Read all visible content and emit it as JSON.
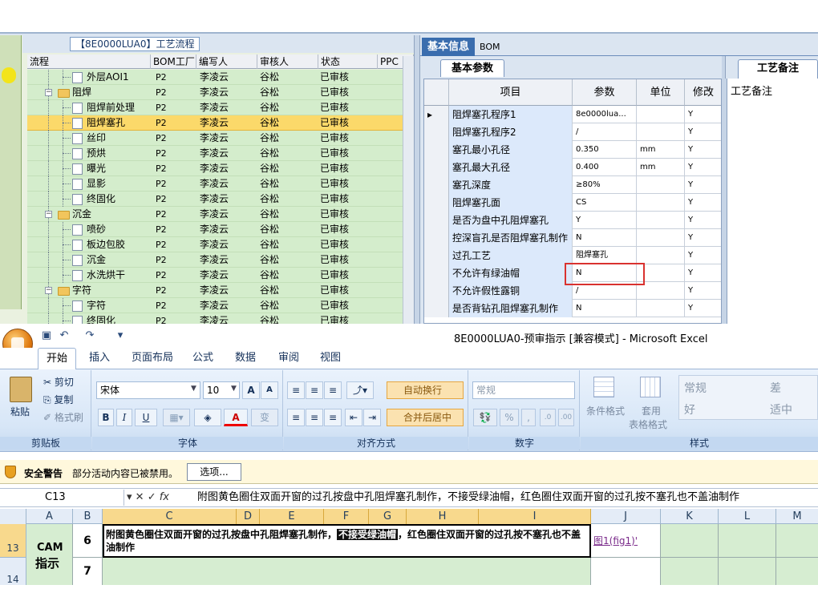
{
  "tree": {
    "title": "【8E0000LUA0】工艺流程",
    "columns": [
      "流程",
      "BOM工厂",
      "编写人",
      "审核人",
      "状态",
      "PPC"
    ],
    "rows": [
      {
        "name": "外层AOI1",
        "level": 2,
        "type": "doc",
        "plant": "P2",
        "writer": "李凌云",
        "reviewer": "谷松",
        "status": "已审核"
      },
      {
        "name": "阻焊",
        "level": 1,
        "type": "folder",
        "plant": "P2",
        "writer": "李凌云",
        "reviewer": "谷松",
        "status": "已审核"
      },
      {
        "name": "阻焊前处理",
        "level": 2,
        "type": "doc",
        "plant": "P2",
        "writer": "李凌云",
        "reviewer": "谷松",
        "status": "已审核"
      },
      {
        "name": "阻焊塞孔",
        "level": 2,
        "type": "doc",
        "plant": "P2",
        "writer": "李凌云",
        "reviewer": "谷松",
        "status": "已审核",
        "selected": true
      },
      {
        "name": "丝印",
        "level": 2,
        "type": "doc",
        "plant": "P2",
        "writer": "李凌云",
        "reviewer": "谷松",
        "status": "已审核"
      },
      {
        "name": "预烘",
        "level": 2,
        "type": "doc",
        "plant": "P2",
        "writer": "李凌云",
        "reviewer": "谷松",
        "status": "已审核"
      },
      {
        "name": "曝光",
        "level": 2,
        "type": "doc",
        "plant": "P2",
        "writer": "李凌云",
        "reviewer": "谷松",
        "status": "已审核"
      },
      {
        "name": "显影",
        "level": 2,
        "type": "doc",
        "plant": "P2",
        "writer": "李凌云",
        "reviewer": "谷松",
        "status": "已审核"
      },
      {
        "name": "终固化",
        "level": 2,
        "type": "doc",
        "plant": "P2",
        "writer": "李凌云",
        "reviewer": "谷松",
        "status": "已审核"
      },
      {
        "name": "沉金",
        "level": 1,
        "type": "folder",
        "plant": "P2",
        "writer": "李凌云",
        "reviewer": "谷松",
        "status": "已审核"
      },
      {
        "name": "喷砂",
        "level": 2,
        "type": "doc",
        "plant": "P2",
        "writer": "李凌云",
        "reviewer": "谷松",
        "status": "已审核"
      },
      {
        "name": "板边包胶",
        "level": 2,
        "type": "doc",
        "plant": "P2",
        "writer": "李凌云",
        "reviewer": "谷松",
        "status": "已审核"
      },
      {
        "name": "沉金",
        "level": 2,
        "type": "doc",
        "plant": "P2",
        "writer": "李凌云",
        "reviewer": "谷松",
        "status": "已审核"
      },
      {
        "name": "水洗烘干",
        "level": 2,
        "type": "doc",
        "plant": "P2",
        "writer": "李凌云",
        "reviewer": "谷松",
        "status": "已审核"
      },
      {
        "name": "字符",
        "level": 1,
        "type": "folder",
        "plant": "P2",
        "writer": "李凌云",
        "reviewer": "谷松",
        "status": "已审核"
      },
      {
        "name": "字符",
        "level": 2,
        "type": "doc",
        "plant": "P2",
        "writer": "李凌云",
        "reviewer": "谷松",
        "status": "已审核"
      },
      {
        "name": "终固化",
        "level": 2,
        "type": "doc",
        "plant": "P2",
        "writer": "李凌云",
        "reviewer": "谷松",
        "status": "已审核"
      }
    ]
  },
  "right": {
    "tabs": [
      "基本信息",
      "BOM"
    ],
    "subtab": "基本参数",
    "columns": [
      "项目",
      "参数",
      "单位",
      "修改"
    ],
    "rows": [
      {
        "item": "阻焊塞孔程序1",
        "param": "8e0000lua...",
        "unit": "",
        "mod": "Y",
        "current": true
      },
      {
        "item": "阻焊塞孔程序2",
        "param": "/",
        "unit": "",
        "mod": "Y"
      },
      {
        "item": "塞孔最小孔径",
        "param": "0.350",
        "unit": "mm",
        "mod": "Y"
      },
      {
        "item": "塞孔最大孔径",
        "param": "0.400",
        "unit": "mm",
        "mod": "Y"
      },
      {
        "item": "塞孔深度",
        "param": "≥80%",
        "unit": "",
        "mod": "Y"
      },
      {
        "item": "阻焊塞孔面",
        "param": "CS",
        "unit": "",
        "mod": "Y"
      },
      {
        "item": "是否为盘中孔阻焊塞孔",
        "param": "Y",
        "unit": "",
        "mod": "Y"
      },
      {
        "item": "控深盲孔是否阻焊塞孔制作",
        "param": "N",
        "unit": "",
        "mod": "Y"
      },
      {
        "item": "过孔工艺",
        "param": "阻焊塞孔",
        "unit": "",
        "mod": "Y"
      },
      {
        "item": "不允许有绿油帽",
        "param": "N",
        "unit": "",
        "mod": "Y"
      },
      {
        "item": "不允许假性露铜",
        "param": "/",
        "unit": "",
        "mod": "Y"
      },
      {
        "item": "是否背钻孔阻焊塞孔制作",
        "param": "N",
        "unit": "",
        "mod": "Y"
      }
    ],
    "note_tab": "工艺备注",
    "note_label": "工艺备注"
  },
  "excel": {
    "window_title": "8E0000LUA0-预审指示 [兼容模式] - Microsoft Excel",
    "tabs": [
      "开始",
      "插入",
      "页面布局",
      "公式",
      "数据",
      "审阅",
      "视图"
    ],
    "clipboard": {
      "paste": "粘贴",
      "cut": "剪切",
      "copy": "复制",
      "format_painter": "格式刷",
      "label": "剪贴板"
    },
    "font": {
      "name": "宋体",
      "size": "10",
      "label": "字体",
      "bold": "B",
      "italic": "I",
      "underline": "U",
      "grow": "A",
      "shrink": "A",
      "color": "A",
      "phonetic": "变"
    },
    "align": {
      "wrap": "自动换行",
      "merge": "合并后居中",
      "label": "对齐方式"
    },
    "number": {
      "format": "常规",
      "percent": "%",
      "comma": ",",
      "label": "数字"
    },
    "styles": {
      "conditional": "条件格式",
      "table": "套用",
      "table2": "表格格式",
      "normal": "常规",
      "bad": "差",
      "good": "好",
      "neutral": "适中",
      "label": "样式"
    },
    "security": {
      "title": "安全警告",
      "message": "部分活动内容已被禁用。",
      "button": "选项..."
    },
    "namebox": "C13",
    "formula_fx": "fx",
    "formula": "附图黄色圈住双面开窗的过孔按盘中孔阻焊塞孔制作，不接受绿油帽，红色圈住双面开窗的过孔按不塞孔也不盖油制作",
    "columns": [
      "A",
      "B",
      "C",
      "D",
      "E",
      "F",
      "G",
      "H",
      "I",
      "J",
      "K",
      "L",
      "M"
    ],
    "row13": {
      "num": "13",
      "a": "CAM",
      "b": "6",
      "c_before": "附图黄色圈住双面开窗的过孔按盘中孔阻焊塞孔制作，",
      "c_highlight": "不接受绿油帽",
      "c_after": "，红色圈住双面开窗的过孔按不塞孔也不盖油制作",
      "j": "图1(fig1)'"
    },
    "row14": {
      "num": "14",
      "a": "指示",
      "b": "7"
    }
  },
  "colors": {
    "accent": "#3a6dae",
    "selected_row": "#fbd96a",
    "tree_bg": "#d4edcc",
    "highlight_box": "#d9322f"
  }
}
